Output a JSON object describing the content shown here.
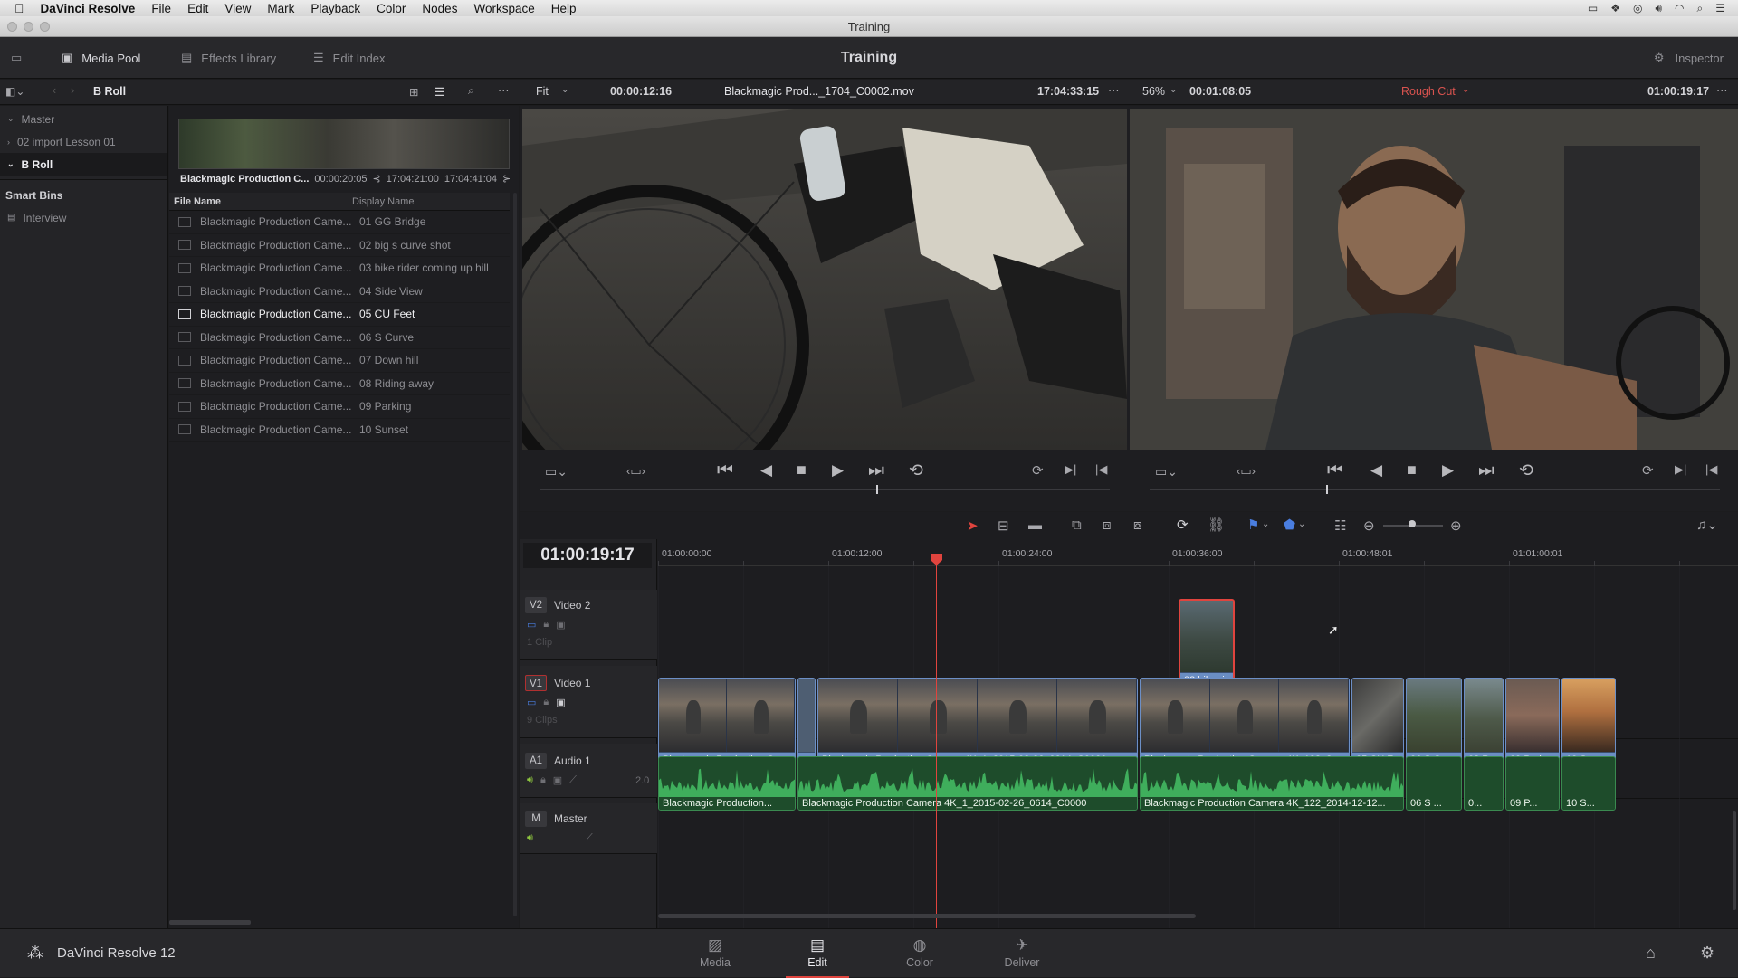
{
  "menubar": {
    "app_name": "DaVinci Resolve",
    "items": [
      "File",
      "Edit",
      "View",
      "Mark",
      "Playback",
      "Color",
      "Nodes",
      "Workspace",
      "Help"
    ]
  },
  "window": {
    "title": "Training"
  },
  "topbar": {
    "media_pool": "Media Pool",
    "effects_library": "Effects Library",
    "edit_index": "Edit Index",
    "project_title": "Training",
    "inspector": "Inspector"
  },
  "bin_bar": {
    "current_bin": "B Roll"
  },
  "bins": {
    "master": "Master",
    "import": "02 import Lesson 01",
    "broll": "B Roll",
    "smart_bins_header": "Smart Bins",
    "interview": "Interview"
  },
  "clip_preview": {
    "name": "Blackmagic Production C...",
    "duration": "00:00:20:05",
    "in": "17:04:21:00",
    "out": "17:04:41:04"
  },
  "media_list": {
    "headers": {
      "file_name": "File Name",
      "display_name": "Display Name"
    },
    "rows": [
      {
        "file": "Blackmagic Production Came...",
        "display": "01 GG Bridge"
      },
      {
        "file": "Blackmagic Production Came...",
        "display": "02 big s curve shot"
      },
      {
        "file": "Blackmagic Production Came...",
        "display": "03 bike rider coming up hill"
      },
      {
        "file": "Blackmagic Production Came...",
        "display": "04 Side View"
      },
      {
        "file": "Blackmagic Production Came...",
        "display": "05 CU Feet",
        "selected": true
      },
      {
        "file": "Blackmagic Production Came...",
        "display": "06 S Curve"
      },
      {
        "file": "Blackmagic Production Came...",
        "display": "07 Down hill"
      },
      {
        "file": "Blackmagic Production Came...",
        "display": "08 Riding away"
      },
      {
        "file": "Blackmagic Production Came...",
        "display": "09 Parking"
      },
      {
        "file": "Blackmagic Production Came...",
        "display": "10 Sunset"
      }
    ]
  },
  "source_viewer": {
    "zoom": "Fit",
    "duration": "00:00:12:16",
    "clip_name": "Blackmagic Prod..._1704_C0002.mov",
    "timecode": "17:04:33:15",
    "playhead_fraction": 0.59
  },
  "timeline_viewer": {
    "zoom": "56%",
    "duration": "00:01:08:05",
    "timeline_name": "Rough Cut",
    "timecode": "01:00:19:17",
    "playhead_fraction": 0.31
  },
  "timeline": {
    "current_timecode": "01:00:19:17",
    "ruler": [
      "01:00:00:00",
      "01:00:12:00",
      "01:00:24:00",
      "01:00:36:00",
      "01:00:48:01",
      "01:01:00:01"
    ],
    "tracks": {
      "v2": {
        "tag": "V2",
        "name": "Video 2",
        "count": "1 Clip"
      },
      "v1": {
        "tag": "V1",
        "name": "Video 1",
        "count": "9 Clips"
      },
      "a1": {
        "tag": "A1",
        "name": "Audio 1",
        "level": "2.0"
      },
      "master": {
        "tag": "M",
        "name": "Master"
      }
    },
    "v2_clips": [
      "03 bike ri..."
    ],
    "v1_clips": [
      "Blackmagic Production Ca...",
      "Blackmagic Production Camera 4K_1_2015-02-26_0614_C0000",
      "Blackmagic Production Camera 4K_122_2...",
      "05 CU F...",
      "06 S Cu...",
      "08 R...",
      "09 Park...",
      "10 Sun..."
    ],
    "a1_clips": [
      "Blackmagic Production...",
      "Blackmagic Production Camera 4K_1_2015-02-26_0614_C0000",
      "Blackmagic Production Camera 4K_122_2014-12-12...",
      "06 S ...",
      "0...",
      "09 P...",
      "10 S..."
    ]
  },
  "footer": {
    "brand": "DaVinci Resolve 12",
    "pages": [
      "Media",
      "Edit",
      "Color",
      "Deliver"
    ],
    "active_page": "Edit"
  },
  "colors": {
    "accent_red": "#e0443e",
    "video_clip": "#6a8ec3",
    "audio_clip": "#1e4c2b",
    "timeline_name": "#d9534f"
  }
}
